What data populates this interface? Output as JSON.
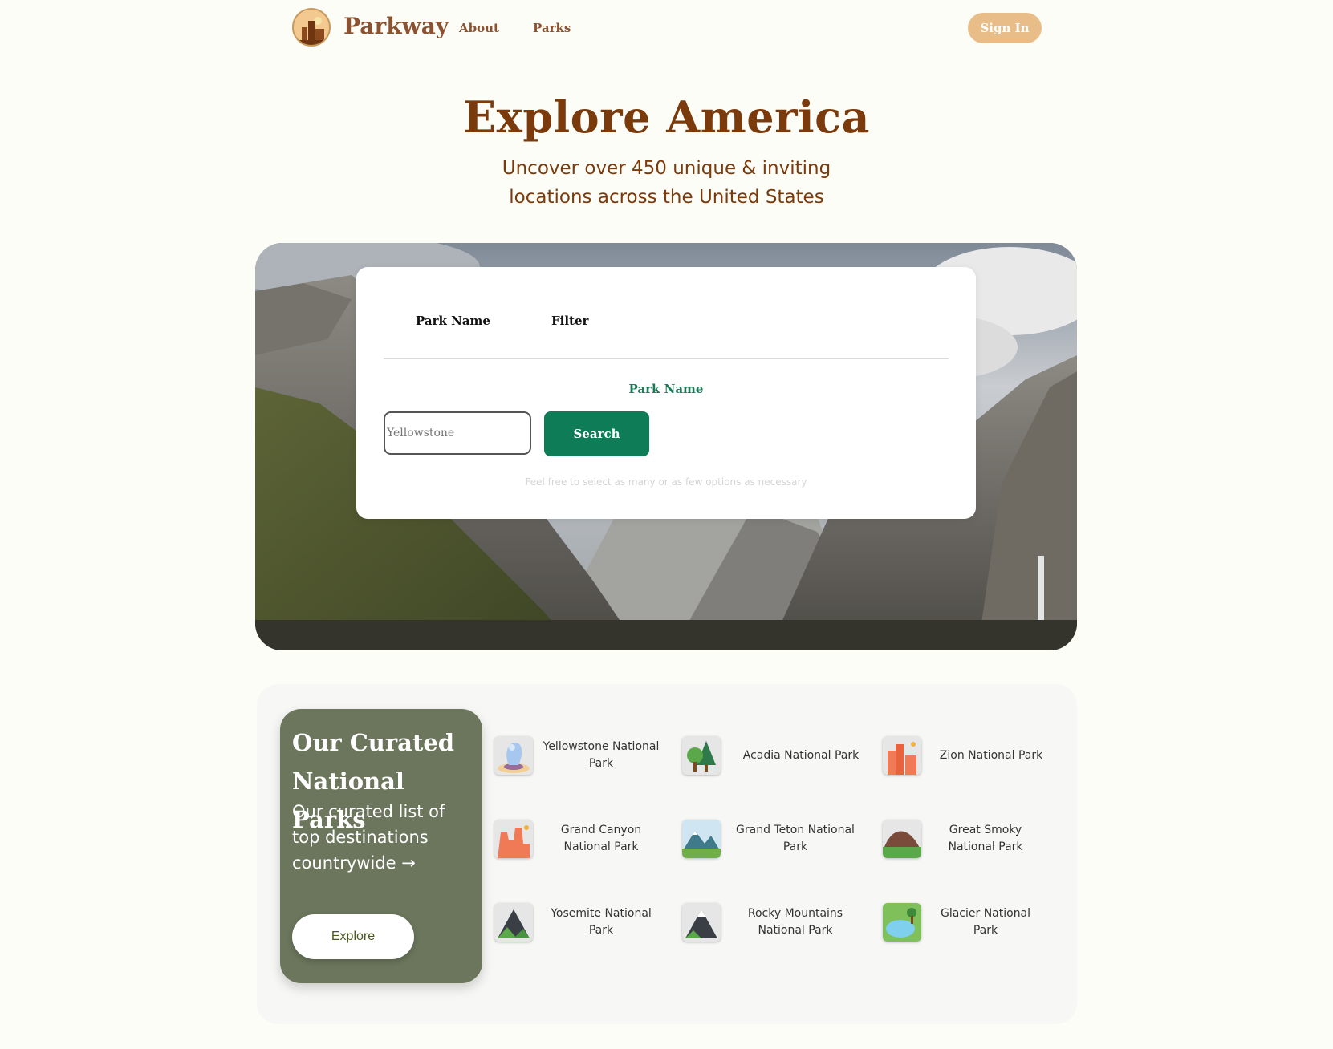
{
  "nav": {
    "brand": "Parkway",
    "links": [
      "About",
      "Parks"
    ],
    "signin": "Sign In",
    "accent": "#e9bd88"
  },
  "hero": {
    "title": "Explore America",
    "subtitle_line1": "Uncover over 450 unique & inviting",
    "subtitle_line2": "locations across the United States"
  },
  "search": {
    "tabs": [
      "Park Name",
      "Filter"
    ],
    "field_label": "Park Name",
    "input_placeholder": "Yellowstone",
    "button": "Search",
    "hint": "Feel free to select as many or as few options as necessary",
    "button_color": "#0e7d57"
  },
  "curated": {
    "title_line1": "Our Curated",
    "title_line2": "National Parks",
    "subtitle": "Our curated list of top destinations countrywide →",
    "explore": "Explore",
    "card_color": "#6b765c",
    "parks": [
      {
        "name": "Yellowstone National Park",
        "icon": "geyser-icon"
      },
      {
        "name": "Acadia National Park",
        "icon": "trees-icon"
      },
      {
        "name": "Zion National Park",
        "icon": "red-rock-icon"
      },
      {
        "name": "Grand Canyon National Park",
        "icon": "canyon-icon"
      },
      {
        "name": "Grand Teton National Park",
        "icon": "snow-mountain-icon"
      },
      {
        "name": "Great Smoky National Park",
        "icon": "hill-icon"
      },
      {
        "name": "Yosemite National Park",
        "icon": "dark-peak-icon"
      },
      {
        "name": "Rocky Mountains National Park",
        "icon": "rocky-peak-icon"
      },
      {
        "name": "Glacier National Park",
        "icon": "lake-icon"
      }
    ]
  }
}
